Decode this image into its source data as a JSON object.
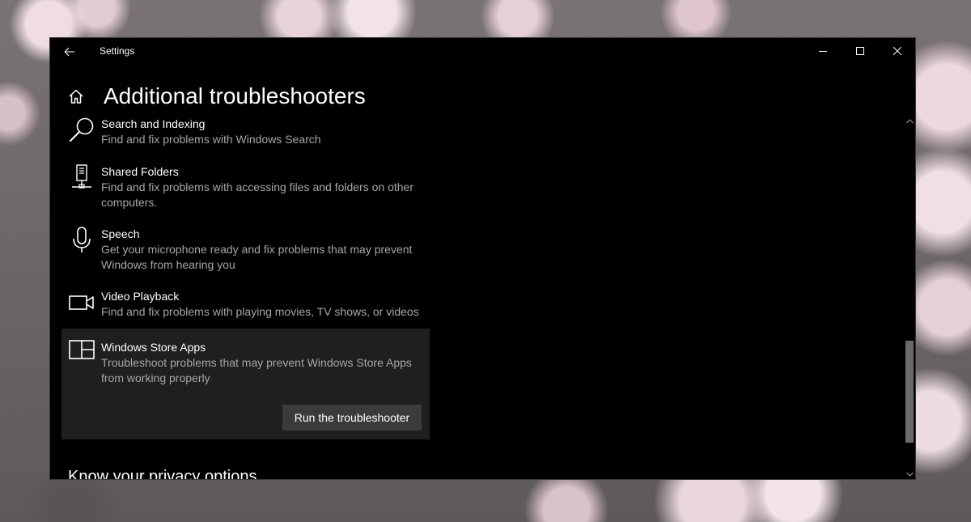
{
  "window": {
    "app_title": "Settings"
  },
  "header": {
    "title": "Additional troubleshooters"
  },
  "troubleshooters": [
    {
      "title": "Search and Indexing",
      "desc": "Find and fix problems with Windows Search",
      "icon": "search-icon"
    },
    {
      "title": "Shared Folders",
      "desc": "Find and fix problems with accessing files and folders on other computers.",
      "icon": "shared-folders-icon"
    },
    {
      "title": "Speech",
      "desc": "Get your microphone ready and fix problems that may prevent Windows from hearing you",
      "icon": "microphone-icon"
    },
    {
      "title": "Video Playback",
      "desc": "Find and fix problems with playing movies, TV shows, or videos",
      "icon": "video-camera-icon"
    },
    {
      "title": "Windows Store Apps",
      "desc": "Troubleshoot problems that may prevent Windows Store Apps from working properly",
      "icon": "store-apps-icon",
      "selected": true
    }
  ],
  "run_button_label": "Run the troubleshooter",
  "section_heading": "Know your privacy options",
  "colors": {
    "window_bg": "#000000",
    "selected_bg": "#1f1f1f",
    "button_bg": "#3b3b3b",
    "desc_text": "#a6a6a6"
  }
}
